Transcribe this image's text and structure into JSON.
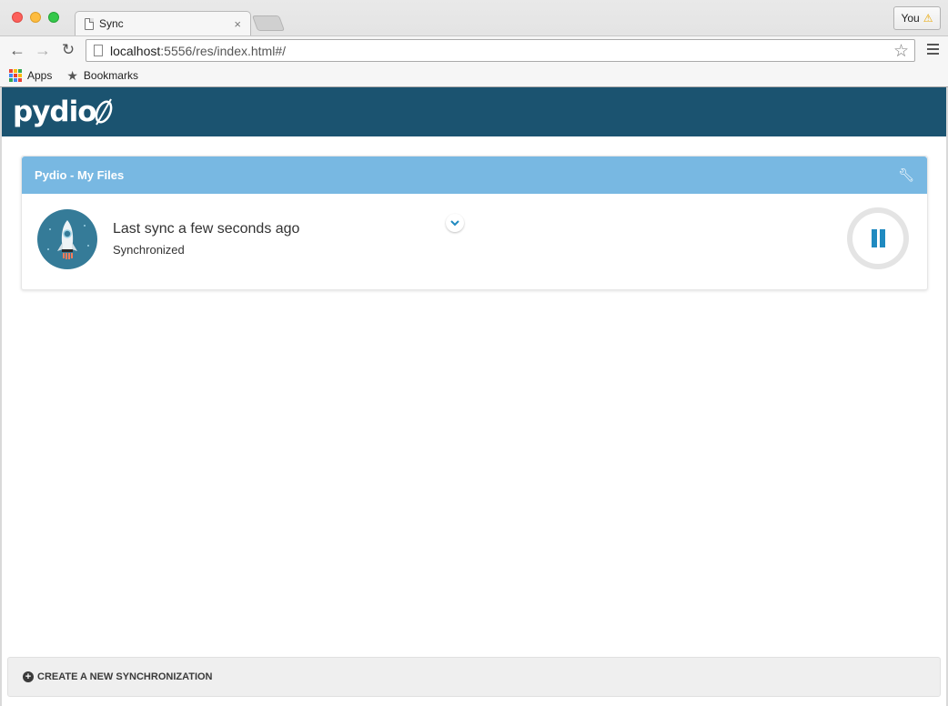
{
  "browser": {
    "tab_title": "Sync",
    "tab_close": "×",
    "profile_label": "You",
    "url_host": "localhost",
    "url_rest": ":5556/res/index.html#/",
    "bookmarks": [
      {
        "label": "Apps",
        "icon": "apps-icon"
      },
      {
        "label": "Bookmarks",
        "icon": "star-icon"
      }
    ]
  },
  "app": {
    "logo_text": "pydio",
    "sync_card": {
      "title": "Pydio - My Files",
      "status_title": "Last sync a few seconds ago",
      "status_sub": "Synchronized",
      "accent": "#78b8e2",
      "pause_color": "#1f8ac0"
    },
    "footer": {
      "create_label": "CREATE A NEW SYNCHRONIZATION"
    },
    "header_color": "#1b5370"
  }
}
